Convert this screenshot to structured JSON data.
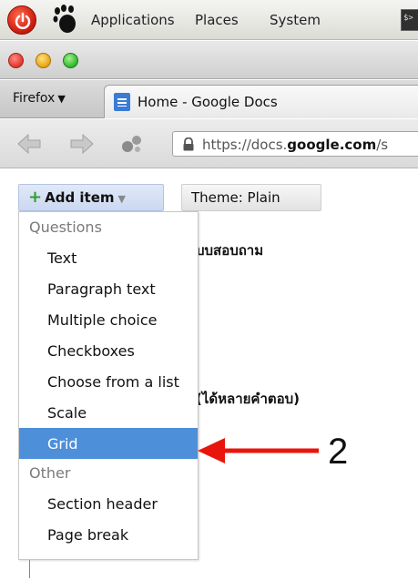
{
  "panel": {
    "menus": [
      "Applications",
      "Places",
      "System"
    ],
    "terminal_glyph": "$>"
  },
  "browser": {
    "firefox_menu_label": "Firefox",
    "firefox_menu_caret": "▼",
    "tab_title": "Home - Google Docs",
    "url_prefix": "https://docs.",
    "url_domain": "google.com",
    "url_suffix": "/s"
  },
  "toolbar": {
    "add_item_plus": "+",
    "add_item_label": "Add item",
    "add_item_caret": "▼",
    "theme_label": "Theme:  Plain"
  },
  "form": {
    "title_fragment": "บบสอบถาม",
    "question_fragment": "(ได้หลายคำตอบ)"
  },
  "menu": {
    "section_questions": "Questions",
    "items": [
      "Text",
      "Paragraph text",
      "Multiple choice",
      "Checkboxes",
      "Choose from a list",
      "Scale",
      "Grid"
    ],
    "selected_item": "Grid",
    "section_other": "Other",
    "other_items": [
      "Section header",
      "Page break"
    ]
  },
  "annotation": {
    "number": "2",
    "arrow_color": "#e8150c"
  },
  "colors": {
    "menu_highlight": "#4d8fd9",
    "add_button_bg": "#d7e2f6"
  }
}
